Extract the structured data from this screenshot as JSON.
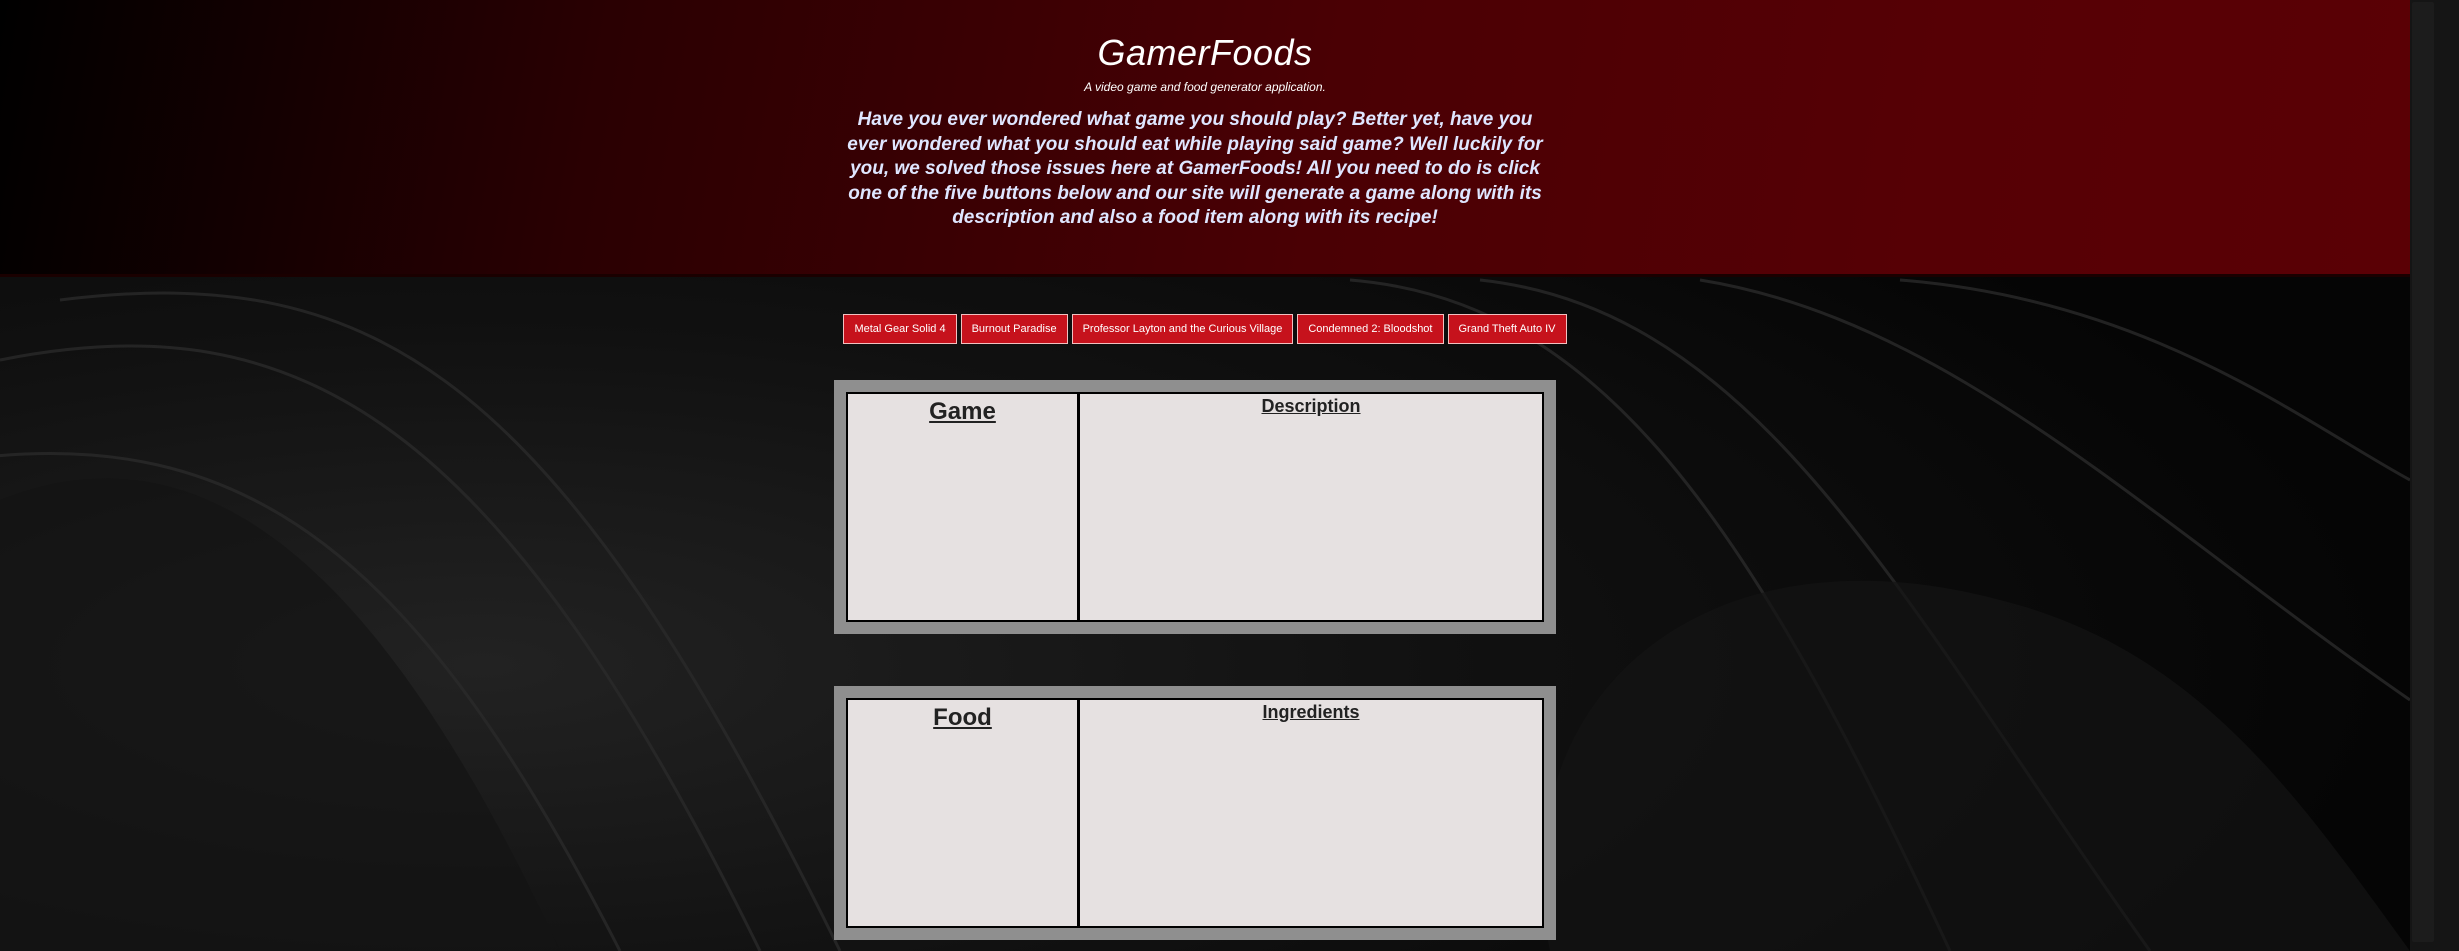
{
  "header": {
    "title": "GamerFoods",
    "subtitle": "A video game and food generator application.",
    "intro": "Have you ever wondered what game you should play? Better yet, have you ever wondered what you should eat while playing said game? Well luckily for you, we solved those issues here at GamerFoods! All you need to do is click one of the five buttons below and our site will generate a game along with its description and also a food item along with its recipe!"
  },
  "buttons": [
    {
      "label": "Metal Gear Solid 4"
    },
    {
      "label": "Burnout Paradise"
    },
    {
      "label": "Professor Layton and the Curious Village"
    },
    {
      "label": "Condemned 2: Bloodshot"
    },
    {
      "label": "Grand Theft Auto IV"
    }
  ],
  "game_panel": {
    "left_heading": "Game",
    "right_heading": "Description"
  },
  "food_panel": {
    "left_heading": "Food",
    "right_heading": "Ingredients"
  },
  "colors": {
    "header_red": "#560005",
    "button_red": "#c6121c",
    "panel_gray": "#8f8f8f",
    "panel_fill": "#e6e1e1"
  }
}
